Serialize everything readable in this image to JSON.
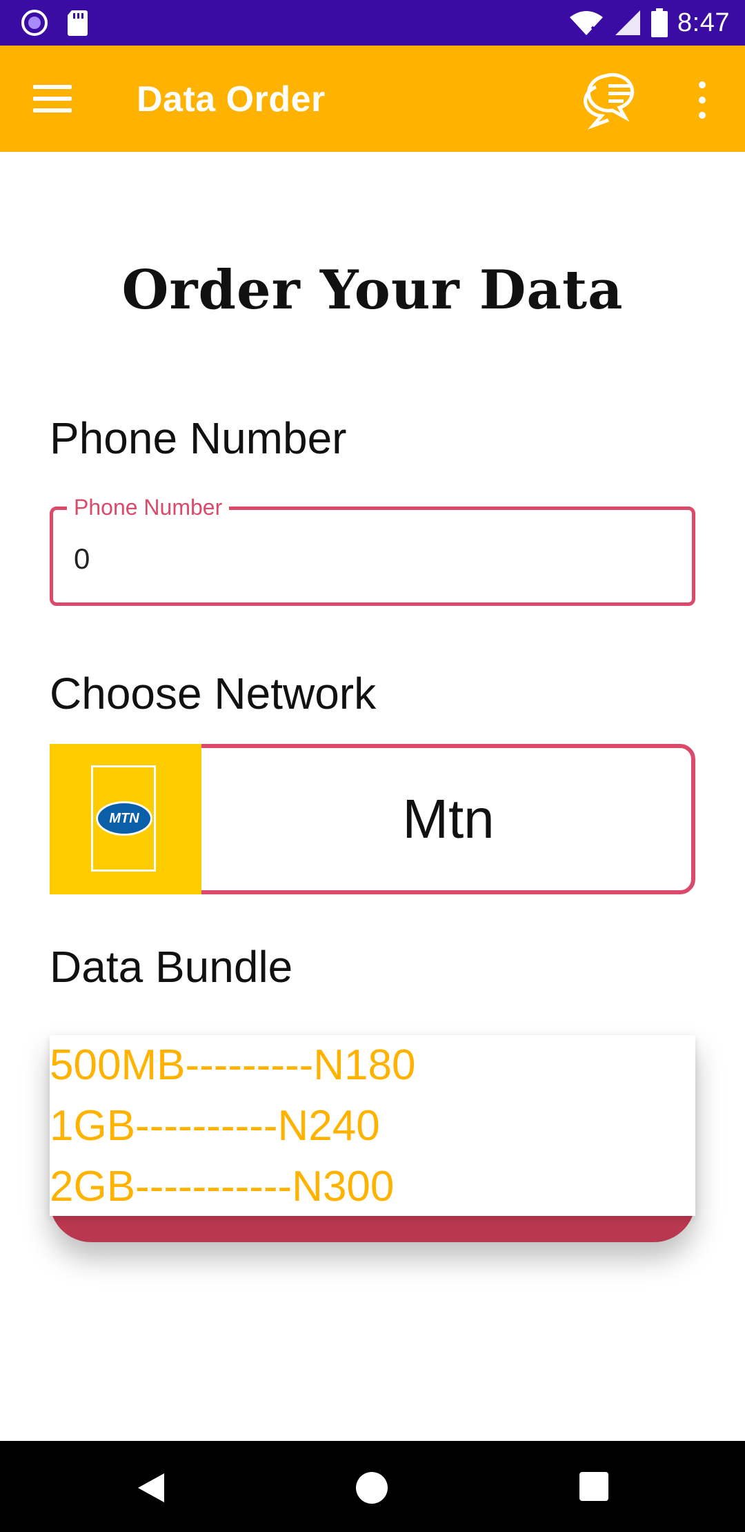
{
  "status_bar": {
    "time": "8:47",
    "icons": [
      "record-icon",
      "sd-card-icon",
      "wifi-icon",
      "signal-icon",
      "battery-icon"
    ]
  },
  "app_bar": {
    "title": "Data Order",
    "icons": [
      "menu-icon",
      "chat-icon",
      "overflow-menu-icon"
    ],
    "color": "#ffb300"
  },
  "heading": "Order Your Data",
  "phone_section": {
    "label": "Phone Number",
    "field_label": "Phone Number",
    "value": "0"
  },
  "network_section": {
    "label": "Choose Network",
    "selected": "Mtn",
    "logo_text": "MTN"
  },
  "bundle_section": {
    "label": "Data Bundle",
    "options": [
      "500MB---------N180",
      "1GB----------N240",
      "2GB-----------N300"
    ]
  },
  "colors": {
    "status_bar": "#3a0ca3",
    "accent": "#ffb300",
    "outline": "#dc4a6b",
    "bundle_bar": "#b9374f"
  },
  "nav_bar": {
    "icons": [
      "back-icon",
      "home-icon",
      "recents-icon"
    ]
  }
}
